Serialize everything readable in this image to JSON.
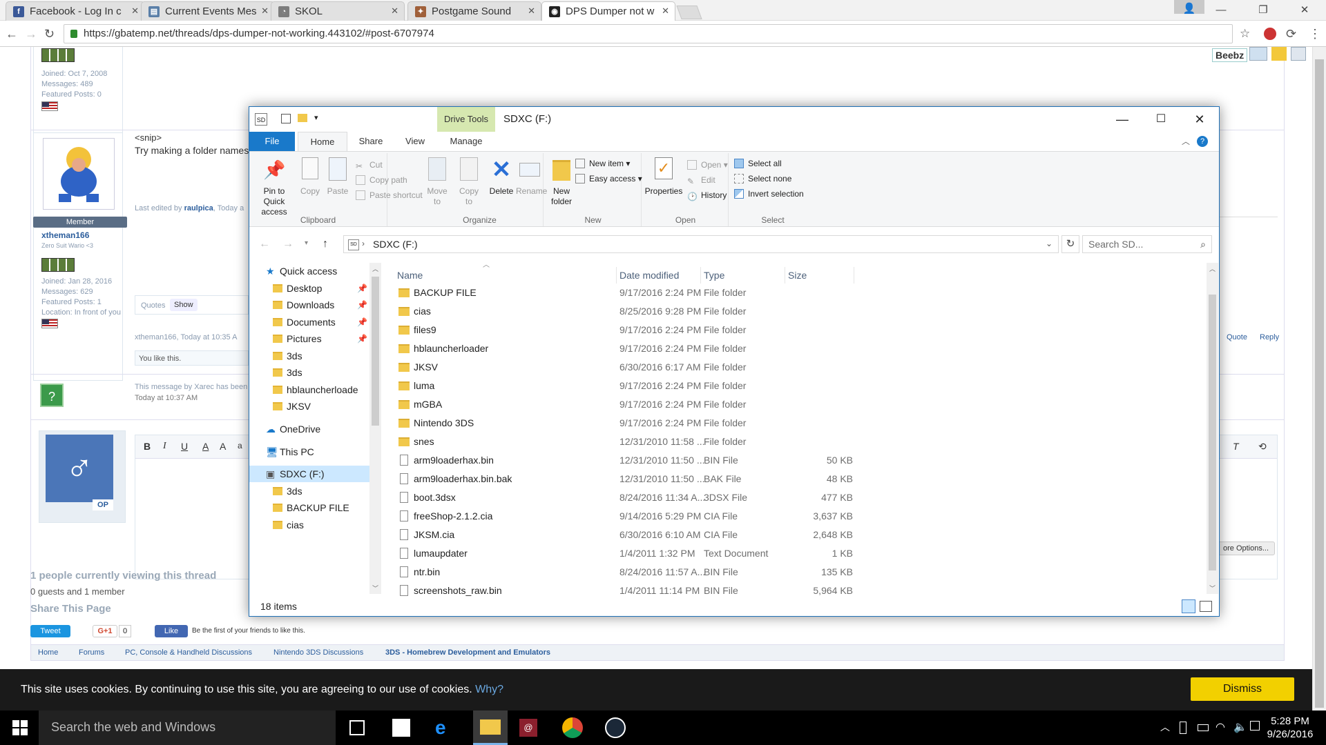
{
  "browser": {
    "tabs": [
      {
        "label": "Facebook - Log In c",
        "icon_color": "#3b5998",
        "icon": "f"
      },
      {
        "label": "Current Events Mes",
        "icon_color": "#5a7fa8",
        "icon": "▤"
      },
      {
        "label": "SKOL",
        "icon_color": "#7c7c7c",
        "icon": "◔"
      },
      {
        "label": "Postgame Sound",
        "icon_color": "#a0603a",
        "icon": "✦"
      },
      {
        "label": "DPS Dumper not w",
        "icon_color": "#222222",
        "icon": "◉"
      }
    ],
    "url": "https://gbatemp.net/threads/dps-dumper-not-working.443102/#post-6707974",
    "user": "Beebz"
  },
  "forum": {
    "post1": {
      "joined": "Joined: Oct 7, 2008",
      "messages": "Messages: 489",
      "featured": "Featured Posts: 0"
    },
    "post2": {
      "snip": "<snip>",
      "text": "Try making a folder names",
      "edited_prefix": "Last edited by",
      "edited_user": "raulpica",
      "edited_suffix": ", Today a",
      "role": "Member",
      "username": "xtheman166",
      "title": "Zero Suit Wario <3",
      "joined": "Joined: Jan 28, 2016",
      "messages": "Messages: 629",
      "featured": "Featured Posts: 1",
      "location": "Location: In front of you",
      "quotes": "Quotes",
      "show": "Show",
      "meta": "xtheman166, Today at 10:35 A",
      "quote": "Quote",
      "reply": "Reply",
      "like": "You like this."
    },
    "deleted": {
      "text": "This message by Xarec has been",
      "time": "Today at 10:37 AM"
    },
    "editor": {
      "bold": "B",
      "italic": "I",
      "underline": "U",
      "op": "OP",
      "more_options": "ore Options..."
    },
    "viewing": "1 people currently viewing this thread",
    "viewers": "0 guests and 1 member",
    "share": "Share This Page",
    "tweet": "Tweet",
    "gplus": "G+1",
    "gcount": "0",
    "fblike": "Like",
    "fbtext": "Be the first of your friends to like this.",
    "breadcrumbs": [
      "Home",
      "Forums",
      "PC, Console & Handheld Discussions",
      "Nintendo 3DS Discussions",
      "3DS - Homebrew Development and Emulators"
    ]
  },
  "cookie": {
    "message": "This site uses cookies. By continuing to use this site, you are agreeing to our use of cookies.",
    "link": "Why?",
    "dismiss": "Dismiss"
  },
  "taskbar": {
    "search": "Search the web and Windows",
    "time": "5:28 PM",
    "date": "9/26/2016"
  },
  "explorer": {
    "title": "SDXC (F:)",
    "drive_tools": "Drive Tools",
    "tabs": {
      "file": "File",
      "home": "Home",
      "share": "Share",
      "view": "View",
      "manage": "Manage"
    },
    "ribbon": {
      "pin": "Pin to Quick access",
      "copy": "Copy",
      "paste": "Paste",
      "cut": "Cut",
      "copy_path": "Copy path",
      "paste_shortcut": "Paste shortcut",
      "clipboard": "Clipboard",
      "move_to": "Move to",
      "copy_to": "Copy to",
      "delete": "Delete",
      "rename": "Rename",
      "organize": "Organize",
      "new_folder": "New folder",
      "new_item": "New item",
      "easy_access": "Easy access",
      "new": "New",
      "properties": "Properties",
      "open": "Open",
      "edit": "Edit",
      "history": "History",
      "open_group": "Open",
      "select_all": "Select all",
      "select_none": "Select none",
      "invert": "Invert selection",
      "select": "Select"
    },
    "address": "SDXC (F:)",
    "search_placeholder": "Search SD...",
    "nav": [
      {
        "label": "Quick access",
        "type": "star",
        "indent": 0
      },
      {
        "label": "Desktop",
        "type": "folder",
        "indent": 1,
        "pin": true
      },
      {
        "label": "Downloads",
        "type": "folder",
        "indent": 1,
        "pin": true
      },
      {
        "label": "Documents",
        "type": "folder",
        "indent": 1,
        "pin": true
      },
      {
        "label": "Pictures",
        "type": "folder",
        "indent": 1,
        "pin": true
      },
      {
        "label": "3ds",
        "type": "folder",
        "indent": 1
      },
      {
        "label": "3ds",
        "type": "folder",
        "indent": 1
      },
      {
        "label": "hblauncherloade",
        "type": "folder",
        "indent": 1
      },
      {
        "label": "JKSV",
        "type": "folder",
        "indent": 1
      },
      {
        "label": "OneDrive",
        "type": "cloud",
        "indent": 0
      },
      {
        "label": "This PC",
        "type": "pc",
        "indent": 0
      },
      {
        "label": "SDXC (F:)",
        "type": "drive",
        "indent": 0,
        "selected": true
      },
      {
        "label": "3ds",
        "type": "folder",
        "indent": 1
      },
      {
        "label": "BACKUP FILE",
        "type": "folder",
        "indent": 1
      },
      {
        "label": "cias",
        "type": "folder",
        "indent": 1
      }
    ],
    "columns": {
      "name": "Name",
      "date": "Date modified",
      "type": "Type",
      "size": "Size"
    },
    "files": [
      {
        "name": "BACKUP FILE",
        "date": "9/17/2016 2:24 PM",
        "type": "File folder",
        "size": "",
        "kind": "folder"
      },
      {
        "name": "cias",
        "date": "8/25/2016 9:28 PM",
        "type": "File folder",
        "size": "",
        "kind": "folder"
      },
      {
        "name": "files9",
        "date": "9/17/2016 2:24 PM",
        "type": "File folder",
        "size": "",
        "kind": "folder"
      },
      {
        "name": "hblauncherloader",
        "date": "9/17/2016 2:24 PM",
        "type": "File folder",
        "size": "",
        "kind": "folder"
      },
      {
        "name": "JKSV",
        "date": "6/30/2016 6:17 AM",
        "type": "File folder",
        "size": "",
        "kind": "folder"
      },
      {
        "name": "luma",
        "date": "9/17/2016 2:24 PM",
        "type": "File folder",
        "size": "",
        "kind": "folder"
      },
      {
        "name": "mGBA",
        "date": "9/17/2016 2:24 PM",
        "type": "File folder",
        "size": "",
        "kind": "folder"
      },
      {
        "name": "Nintendo 3DS",
        "date": "9/17/2016 2:24 PM",
        "type": "File folder",
        "size": "",
        "kind": "folder"
      },
      {
        "name": "snes",
        "date": "12/31/2010 11:58 ...",
        "type": "File folder",
        "size": "",
        "kind": "folder"
      },
      {
        "name": "arm9loaderhax.bin",
        "date": "12/31/2010 11:50 ...",
        "type": "BIN File",
        "size": "50 KB",
        "kind": "file"
      },
      {
        "name": "arm9loaderhax.bin.bak",
        "date": "12/31/2010 11:50 ...",
        "type": "BAK File",
        "size": "48 KB",
        "kind": "file"
      },
      {
        "name": "boot.3dsx",
        "date": "8/24/2016 11:34 A...",
        "type": "3DSX File",
        "size": "477 KB",
        "kind": "file"
      },
      {
        "name": "freeShop-2.1.2.cia",
        "date": "9/14/2016 5:29 PM",
        "type": "CIA File",
        "size": "3,637 KB",
        "kind": "file"
      },
      {
        "name": "JKSM.cia",
        "date": "6/30/2016 6:10 AM",
        "type": "CIA File",
        "size": "2,648 KB",
        "kind": "file"
      },
      {
        "name": "lumaupdater",
        "date": "1/4/2011 1:32 PM",
        "type": "Text Document",
        "size": "1 KB",
        "kind": "file"
      },
      {
        "name": "ntr.bin",
        "date": "8/24/2016 11:57 A...",
        "type": "BIN File",
        "size": "135 KB",
        "kind": "file"
      },
      {
        "name": "screenshots_raw.bin",
        "date": "1/4/2011 11:14 PM",
        "type": "BIN File",
        "size": "5,964 KB",
        "kind": "file"
      }
    ],
    "status": "18 items"
  }
}
